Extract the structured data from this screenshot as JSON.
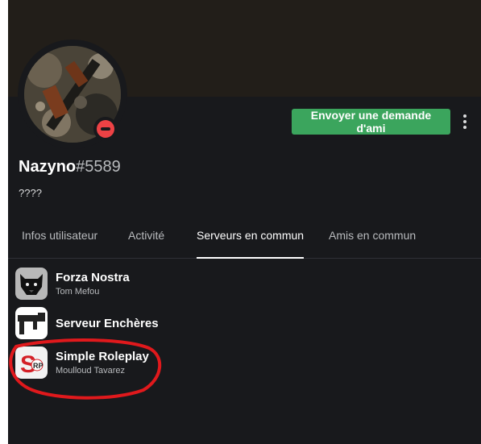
{
  "profile": {
    "username": "Nazyno",
    "discriminator": "#5589",
    "custom_status": "????",
    "status": "do-not-disturb",
    "status_color": "#ed4245"
  },
  "actions": {
    "friend_request_label": "Envoyer une demande d'ami",
    "friend_request_color": "#3ba55d",
    "more_icon": "more-vertical-icon"
  },
  "tabs": [
    {
      "label": "Infos utilisateur",
      "active": false
    },
    {
      "label": "Activité",
      "active": false
    },
    {
      "label": "Serveurs en commun",
      "active": true
    },
    {
      "label": "Amis en commun",
      "active": false
    }
  ],
  "servers": [
    {
      "name": "Forza Nostra",
      "nickname": "Tom Mefou",
      "icon": "forza-nostra-panther-icon"
    },
    {
      "name": "Serveur Enchères",
      "nickname": "",
      "icon": "serveur-encheres-gun-icon"
    },
    {
      "name": "Simple Roleplay",
      "nickname": "Moulloud Tavarez",
      "icon": "simple-roleplay-logo-icon"
    }
  ],
  "annotation": {
    "shape": "red-circle-highlight",
    "color": "#e0191c"
  }
}
